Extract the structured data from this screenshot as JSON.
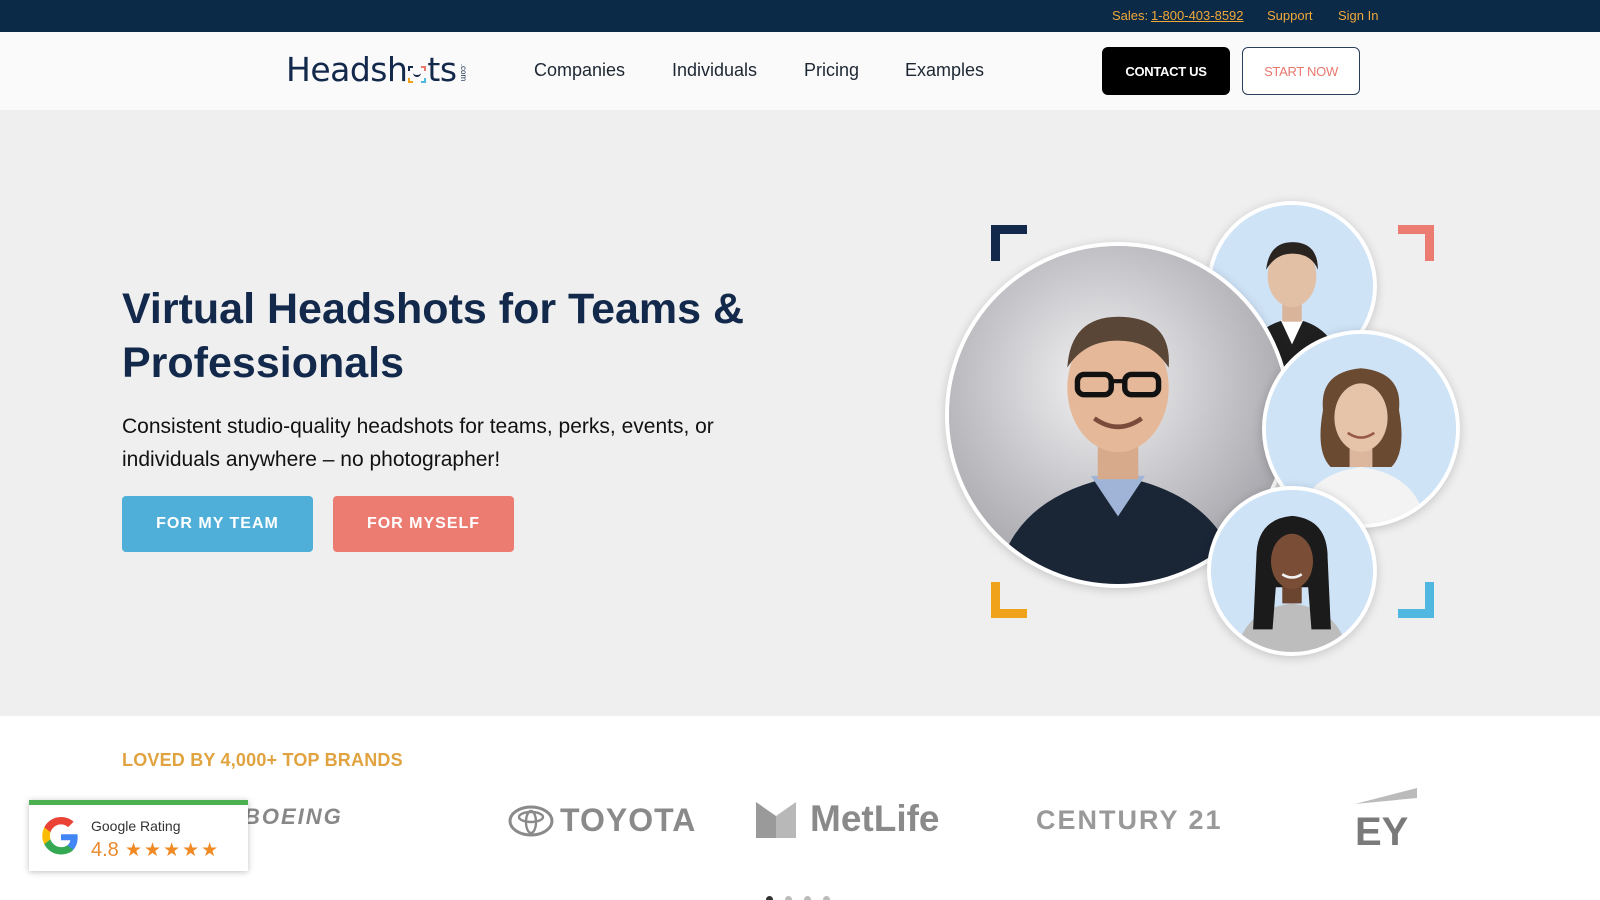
{
  "topbar": {
    "sales_label": "Sales:",
    "sales_phone": "1-800-403-8592",
    "support": "Support",
    "sign_in": "Sign In"
  },
  "header": {
    "logo_left": "Headsh",
    "logo_right": "ts",
    "logo_suffix": ".com",
    "nav": [
      {
        "label": "Companies"
      },
      {
        "label": "Individuals"
      },
      {
        "label": "Pricing"
      },
      {
        "label": "Examples"
      }
    ],
    "contact_button": "CONTACT US",
    "start_button": "START NOW"
  },
  "hero": {
    "title": "Virtual Headshots for Teams & Professionals",
    "subtitle": "Consistent studio-quality headshots for teams, perks, events, or individuals anywhere – no photographer!",
    "team_button": "FOR MY TEAM",
    "myself_button": "FOR MYSELF"
  },
  "brands": {
    "title": "LOVED BY 4,000+ TOP BRANDS",
    "logos": [
      "BOEING",
      "TOYOTA",
      "MetLife",
      "CENTURY 21",
      "EY"
    ],
    "carousel_pages": 4,
    "active_page": 1
  },
  "google_badge": {
    "label": "Google Rating",
    "score": "4.8",
    "stars": "★★★★★"
  },
  "colors": {
    "navy": "#13294b",
    "topbar": "#0b2a47",
    "accent_orange": "#f0a83a",
    "coral": "#ec7c72",
    "sky": "#4fafd8",
    "gold_heading": "#e0a33f"
  }
}
